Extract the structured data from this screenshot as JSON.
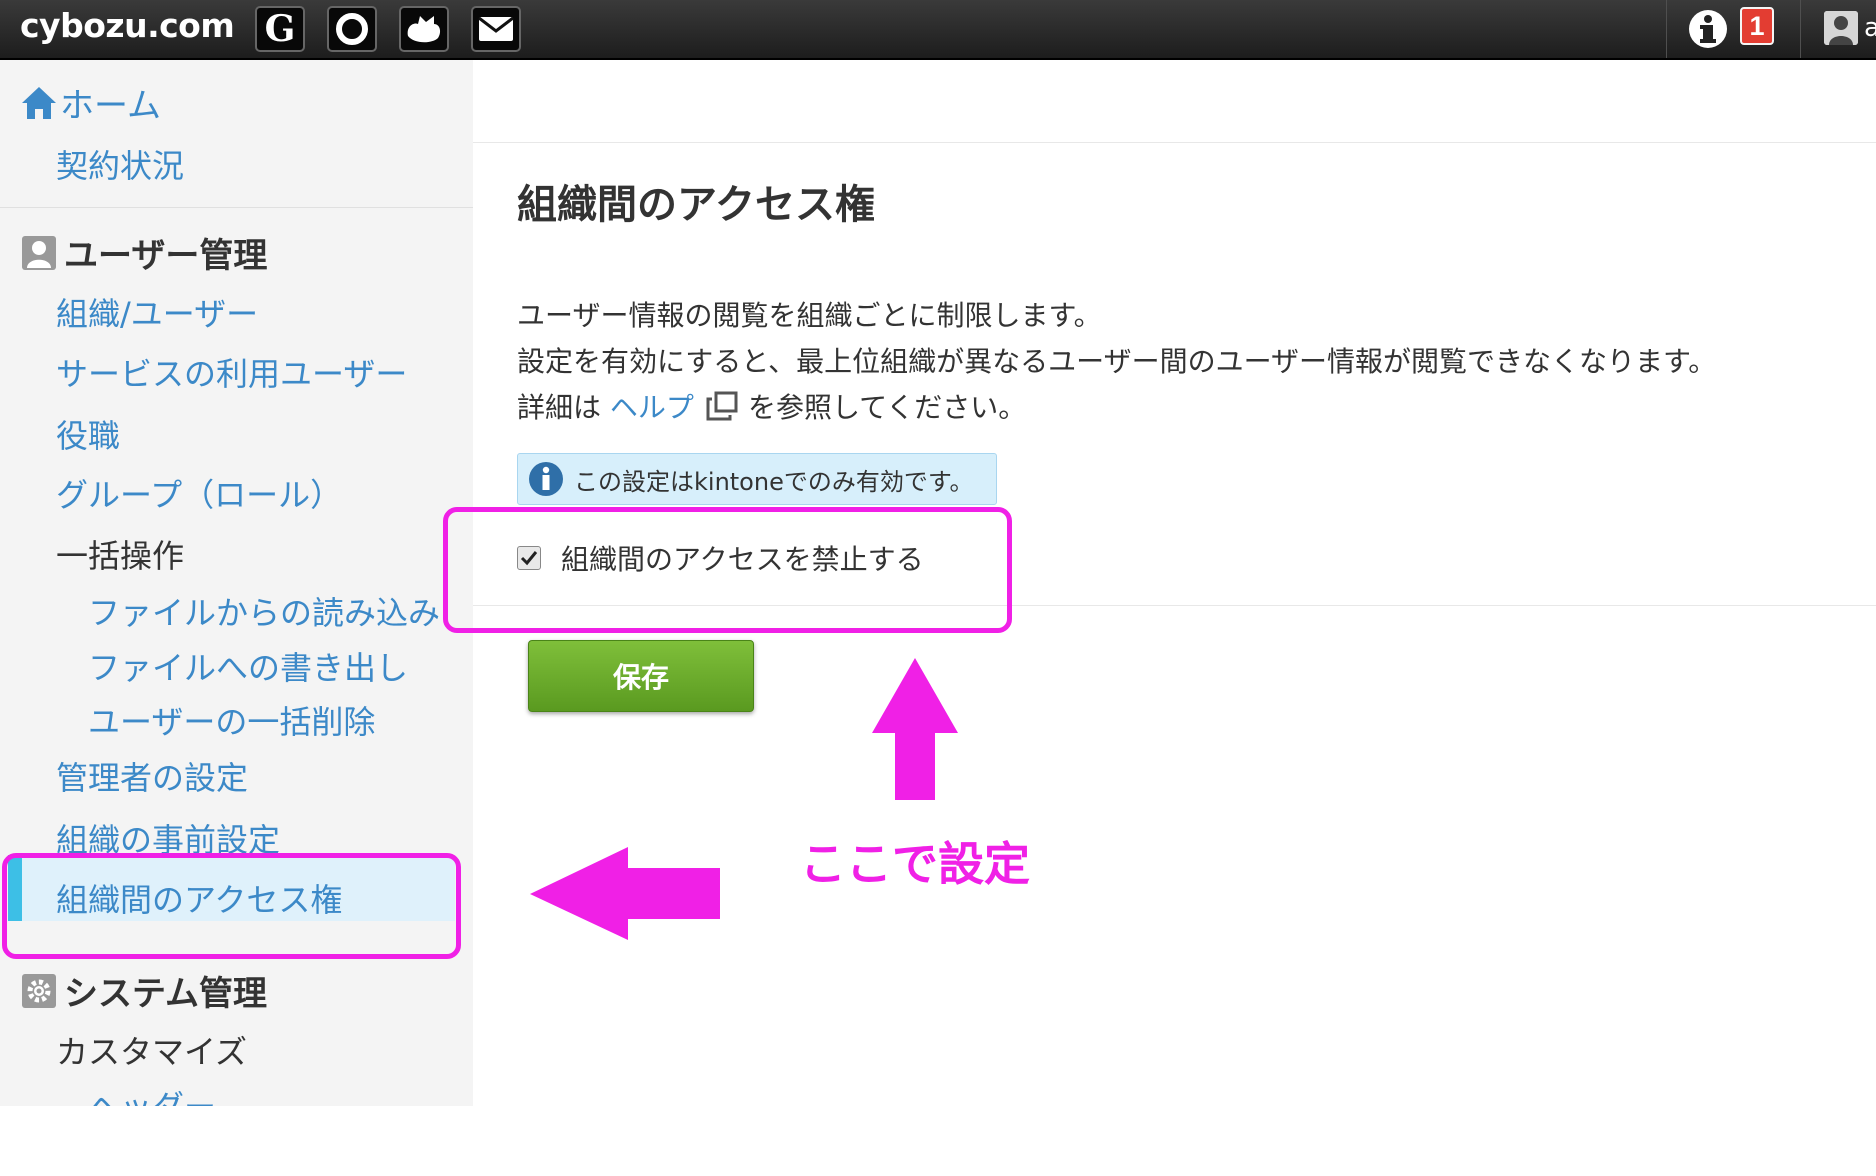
{
  "topbar": {
    "logo": "cybozu.com",
    "services": [
      {
        "name": "garoon",
        "glyph": "G"
      },
      {
        "name": "office"
      },
      {
        "name": "kintone"
      },
      {
        "name": "mailwise"
      }
    ],
    "notification_count": "1",
    "user_edge_char": "a"
  },
  "sidebar": {
    "home": "ホーム",
    "contract": "契約状況",
    "user_management": "ユーザー管理",
    "items": [
      "組織/ユーザー",
      "サービスの利用ユーザー",
      "役職",
      "グループ（ロール）",
      "一括操作",
      "ファイルからの読み込み",
      "ファイルへの書き出し",
      "ユーザーの一括削除",
      "管理者の設定",
      "組織の事前設定",
      "組織間のアクセス権"
    ],
    "system_management": "システム管理",
    "customize": "カスタマイズ",
    "header_partial": "ヘッダー"
  },
  "main": {
    "title": "組織間のアクセス権",
    "description_line1": "ユーザー情報の閲覧を組織ごとに制限します。",
    "description_line2": "設定を有効にすると、最上位組織が異なるユーザー間のユーザー情報が閲覧できなくなります。",
    "description_prefix": "詳細は",
    "help_link": "ヘルプ",
    "description_suffix": "を参照してください。",
    "notice": "この設定はkintoneでのみ有効です。",
    "checkbox_label": "組織間のアクセスを禁止する",
    "checkbox_checked": true,
    "save_button": "保存"
  },
  "annotation": {
    "label": "ここで設定",
    "color": "#f020e6"
  }
}
